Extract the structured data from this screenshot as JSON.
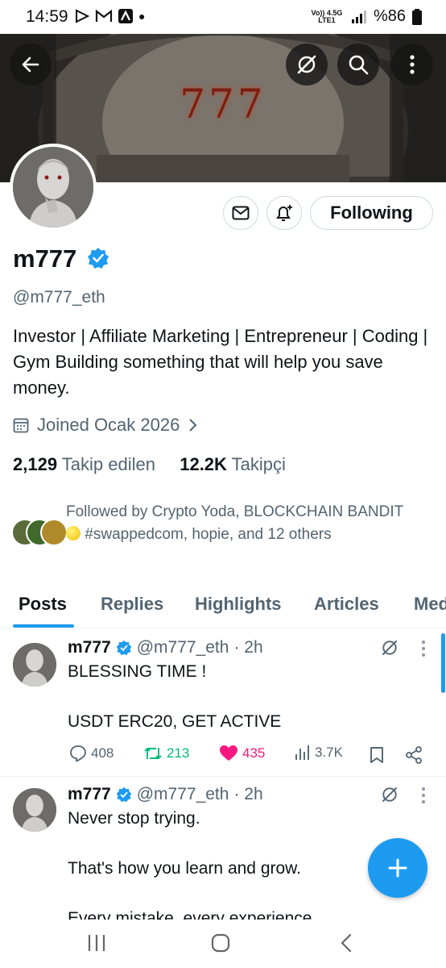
{
  "status_bar": {
    "time": "14:59",
    "network": "Vo)) 4.5G LTE1",
    "battery": "%86"
  },
  "profile": {
    "banner_text": "777",
    "name": "m777",
    "handle": "@m777_eth",
    "bio": "Investor | Affiliate Marketing | Entrepreneur | Coding | Gym Building something that will help you save money.",
    "joined": "Joined Ocak 2026",
    "following_count": "2,129",
    "following_label": "Takip edilen",
    "followers_count": "12.2K",
    "followers_label": "Takipçi",
    "followed_by_prefix": "Followed by Crypto Yoda, BLOCKCHAIN BANDIT",
    "followed_by_suffix": "#swappedcom, hopie, and 12 others"
  },
  "buttons": {
    "following": "Following"
  },
  "tabs": [
    {
      "label": "Posts",
      "active": true
    },
    {
      "label": "Replies",
      "active": false
    },
    {
      "label": "Highlights",
      "active": false
    },
    {
      "label": "Articles",
      "active": false
    },
    {
      "label": "Media",
      "active": false
    }
  ],
  "tweets": [
    {
      "name": "m777",
      "handle": "@m777_eth",
      "time": "· 2h",
      "lines": [
        "BLESSING TIME !",
        "",
        "USDT ERC20, GET ACTIVE"
      ],
      "replies": "408",
      "reposts": "213",
      "likes": "435",
      "views": "3.7K"
    },
    {
      "name": "m777",
      "handle": "@m777_eth",
      "time": "· 2h",
      "lines": [
        "Never stop trying.",
        "",
        "That's how you learn and grow.",
        "",
        "Every mistake, every experience"
      ]
    }
  ],
  "colors": {
    "accent": "#1d9bf0",
    "like": "#f91880",
    "repost": "#00ba7c",
    "muted": "#536471"
  }
}
